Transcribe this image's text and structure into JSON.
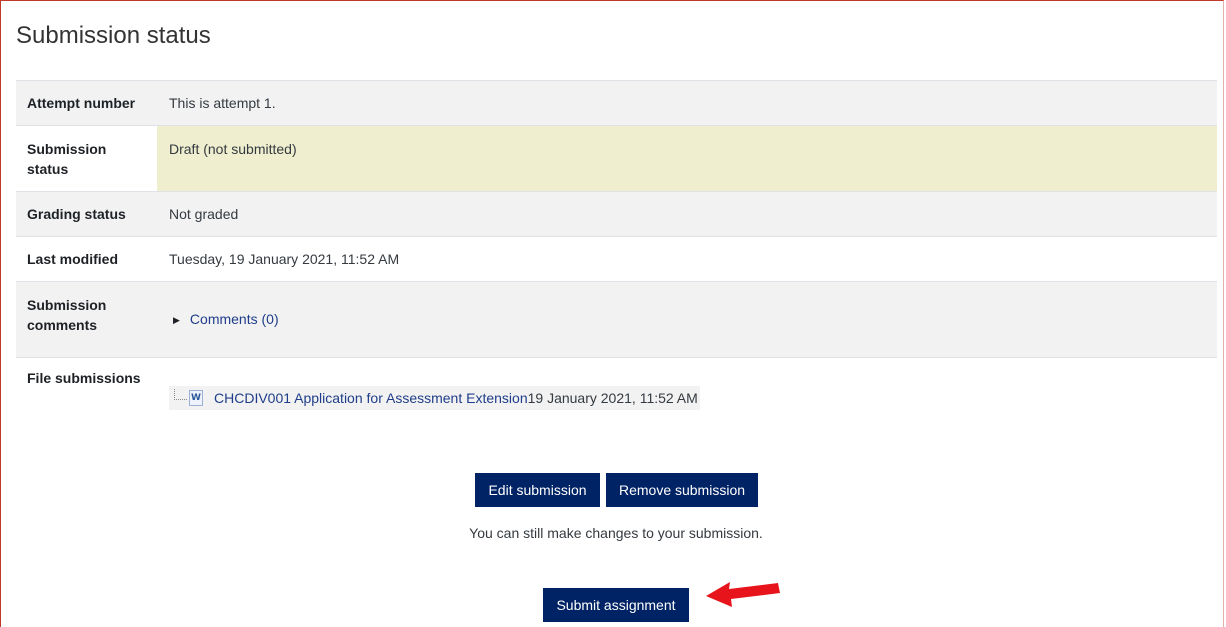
{
  "page": {
    "title": "Submission status"
  },
  "status_table": {
    "rows": [
      {
        "label": "Attempt number",
        "value": "This is attempt 1."
      },
      {
        "label_line1": "Submission",
        "label_line2": "status",
        "value": "Draft (not submitted)"
      },
      {
        "label": "Grading status",
        "value": "Not graded"
      },
      {
        "label": "Last modified",
        "value": "Tuesday, 19 January 2021, 11:52 AM"
      },
      {
        "label_line1": "Submission",
        "label_line2": "comments",
        "link": "Comments (0)"
      },
      {
        "label": "File submissions",
        "file_name": "CHCDIV001 Application for Assessment Extension",
        "file_date": "19 January 2021, 11:52 AM",
        "file_icon": "word-file-icon"
      }
    ]
  },
  "actions": {
    "edit_label": "Edit submission",
    "remove_label": "Remove submission",
    "note": "You can still make changes to your submission.",
    "submit_label": "Submit assignment"
  },
  "colors": {
    "button": "#002365",
    "link": "#1f3d8a",
    "draft_highlight": "#efeecf",
    "annotation_arrow": "#e8141b"
  }
}
